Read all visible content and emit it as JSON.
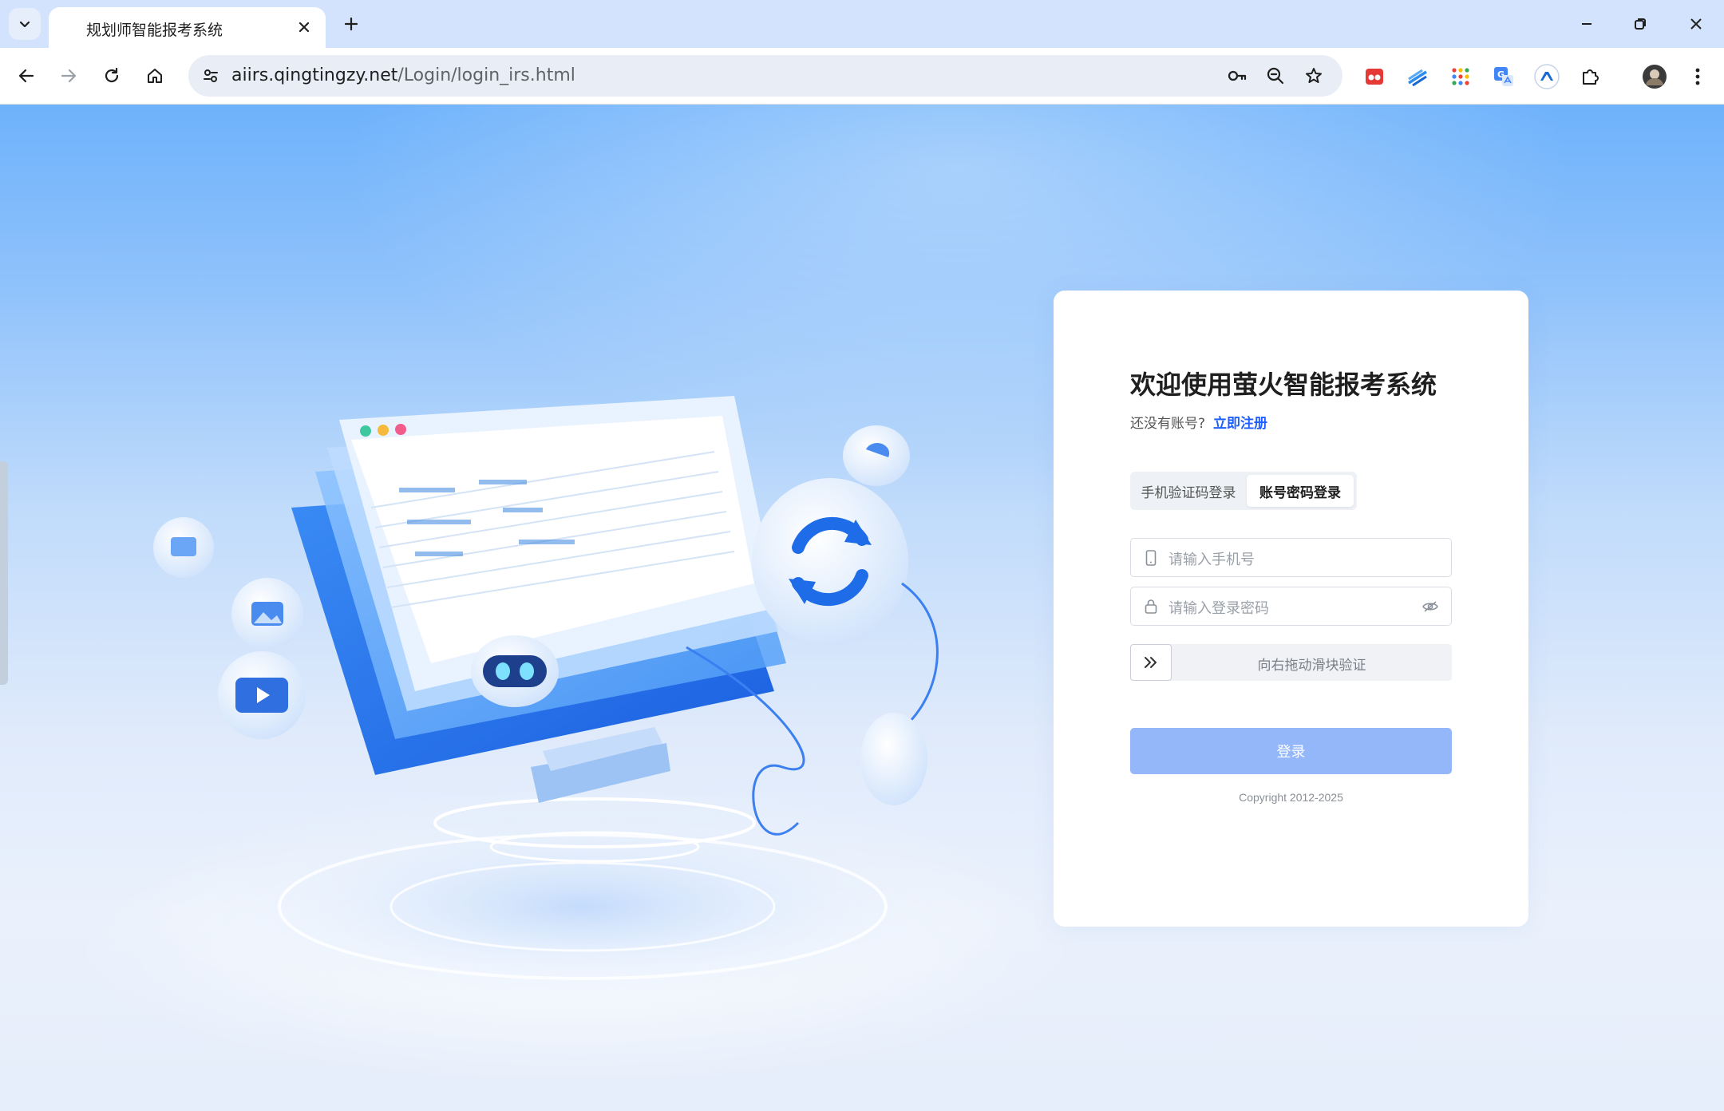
{
  "browser": {
    "tab_title": "规划师智能报考系统",
    "url_host": "aiirs.qingtingzy.net",
    "url_path": "/Login/login_irs.html"
  },
  "card": {
    "title": "欢迎使用萤火智能报考系统",
    "no_account": "还没有账号?",
    "register_link": "立即注册",
    "tabs": [
      {
        "label": "手机验证码登录",
        "active": false
      },
      {
        "label": "账号密码登录",
        "active": true
      }
    ],
    "phone_placeholder": "请输入手机号",
    "password_placeholder": "请输入登录密码",
    "slider_text": "向右拖动滑块验证",
    "login_label": "登录",
    "copyright": "Copyright 2012-2025"
  },
  "colors": {
    "accent": "#1f5eff",
    "login_button": "#93b7f8",
    "tabbar": "#d3e3fd"
  }
}
